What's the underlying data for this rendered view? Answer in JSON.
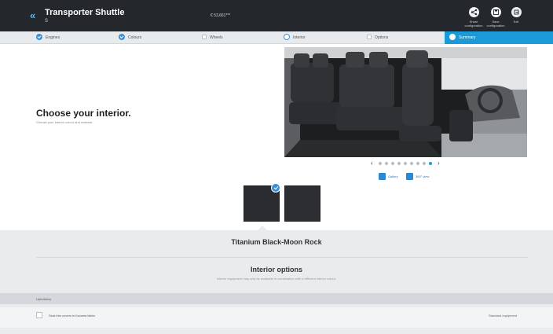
{
  "header": {
    "title": "Transporter Shuttle",
    "subtitle": "S",
    "price": "€ 53,661***",
    "buttons": [
      {
        "label": "Share configuration",
        "icon": "share-icon"
      },
      {
        "label": "Save configuration",
        "icon": "save-icon"
      },
      {
        "label": "Exit",
        "icon": "exit-icon"
      }
    ]
  },
  "steps": [
    {
      "label": "Engines",
      "state": "done"
    },
    {
      "label": "Colours",
      "state": "done"
    },
    {
      "label": "Wheels",
      "state": "empty"
    },
    {
      "label": "Interior",
      "state": "current"
    },
    {
      "label": "Options",
      "state": "empty"
    },
    {
      "label": "Summary",
      "state": "active"
    }
  ],
  "intro": {
    "heading": "Choose your interior.",
    "subheading": "Choose your interior colour and material."
  },
  "gallery": {
    "total_dots": 9,
    "active_dot": 8,
    "gallery_label": "Gallery",
    "view360_label": "360° view"
  },
  "swatches": [
    {
      "name": "Titanium Black-Moon Rock",
      "selected": true,
      "color": "#2b2c2f"
    },
    {
      "name": "swatch-2",
      "selected": false,
      "color": "#2d2e31"
    }
  ],
  "selected_trim": "Titanium Black-Moon Rock",
  "options": {
    "title": "Interior options",
    "subtitle": "Interior equipment may only be available in combination with a different interior colour.",
    "category": "Upholstery",
    "rows": [
      {
        "label": "Seat trim covers in Kurama fabric",
        "right": "Standard equipment"
      }
    ]
  },
  "colors": {
    "header_bg": "#24272b",
    "accent": "#1a9bd8",
    "check_blue": "#3d8ed4"
  }
}
